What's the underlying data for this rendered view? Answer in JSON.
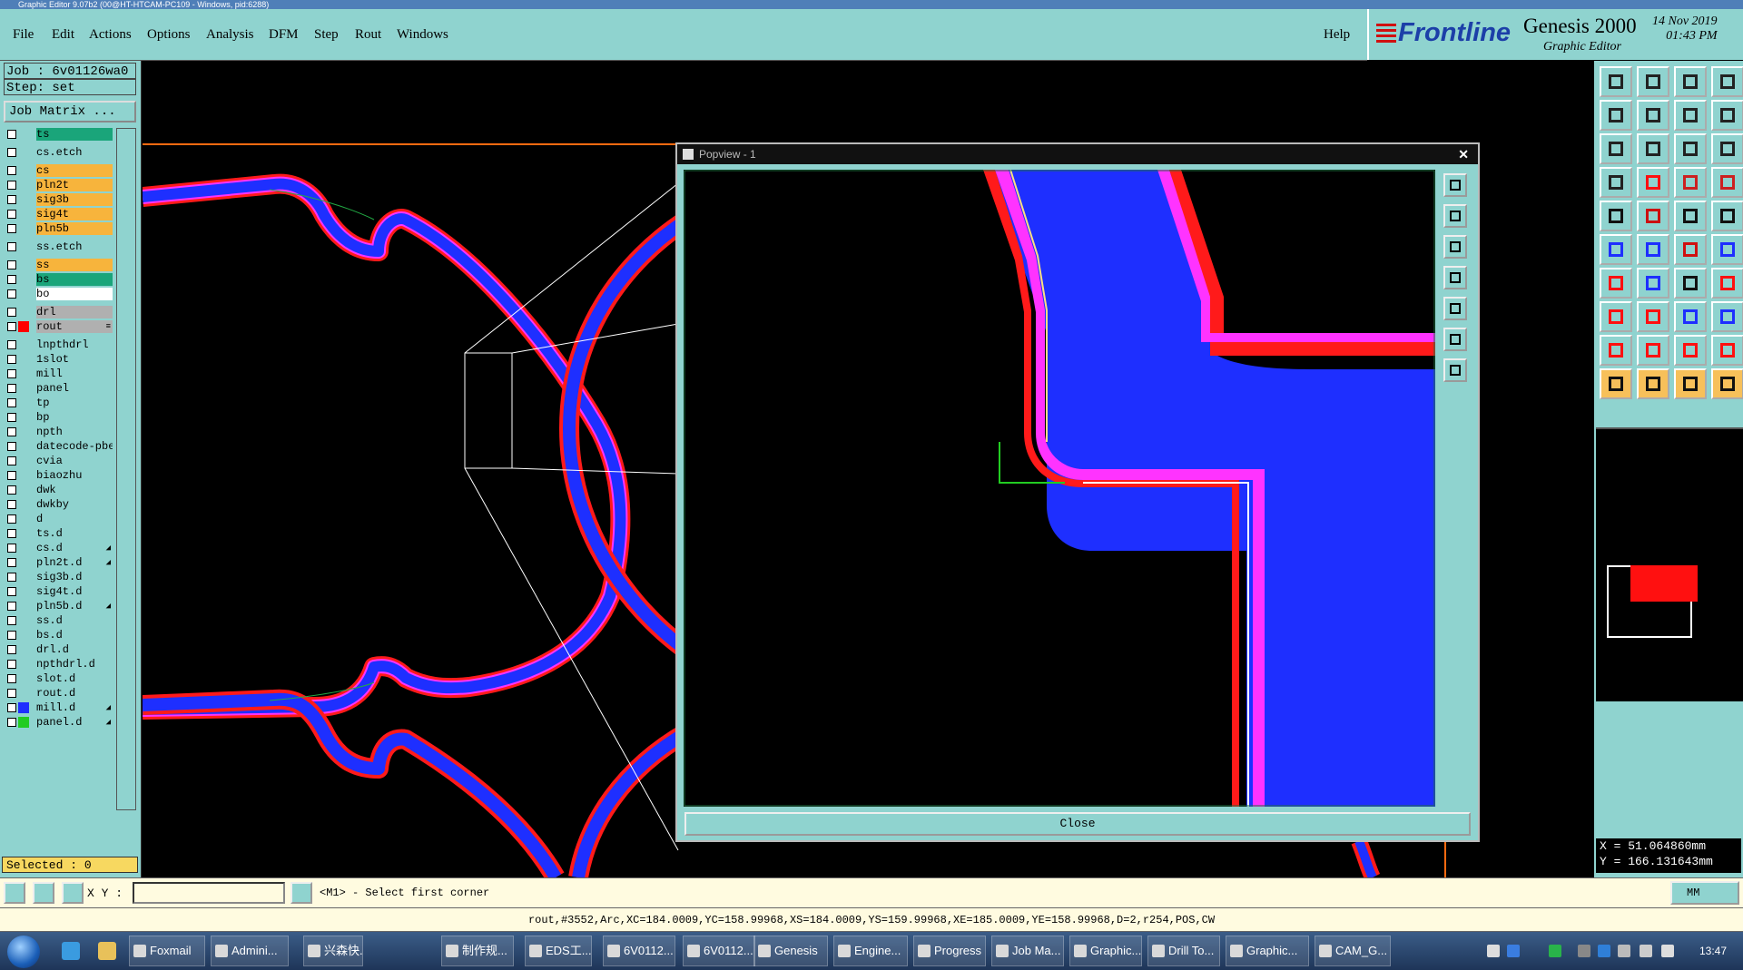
{
  "window": {
    "title": "Graphic Editor 9.07b2 (00@HT-HTCAM-PC109 - Windows, pid:6288)"
  },
  "menu": {
    "items": [
      "File",
      "Edit",
      "Actions",
      "Options",
      "Analysis",
      "DFM",
      "Step",
      "Rout",
      "Windows"
    ],
    "help": "Help"
  },
  "brand": {
    "logo": "Frontline",
    "product": "Genesis 2000",
    "module": "Graphic Editor",
    "date": "14 Nov 2019",
    "time": "01:43 PM"
  },
  "job": {
    "job_line": "Job  :  6v01126wa0",
    "step_line": "Step:  set",
    "matrix_button": "Job Matrix ...",
    "selected": "Selected : 0"
  },
  "layers": [
    {
      "name": "ts",
      "color": "#1aa57a"
    },
    {
      "name": "cs.etch",
      "color": "#8fd3cf"
    },
    {
      "name": "cs",
      "color": "#f7b43c"
    },
    {
      "name": "pln2t",
      "color": "#f7b43c"
    },
    {
      "name": "sig3b",
      "color": "#f7b43c"
    },
    {
      "name": "sig4t",
      "color": "#f7b43c"
    },
    {
      "name": "pln5b",
      "color": "#f7b43c"
    },
    {
      "name": "ss.etch",
      "color": "#8fd3cf"
    },
    {
      "name": "ss",
      "color": "#f7b43c"
    },
    {
      "name": "bs",
      "color": "#1aa57a"
    },
    {
      "name": "bo",
      "color": "#ffffff"
    },
    {
      "name": "drl",
      "color": "#b0b0b0"
    },
    {
      "name": "rout",
      "color": "#b0b0b0",
      "swatch": "#ff0000",
      "edit": "≡"
    },
    {
      "name": "lnpthdrl",
      "color": "#8fd3cf"
    },
    {
      "name": "1slot",
      "color": "#8fd3cf"
    },
    {
      "name": "mill",
      "color": "#8fd3cf"
    },
    {
      "name": "panel",
      "color": "#8fd3cf"
    },
    {
      "name": "tp",
      "color": "#8fd3cf"
    },
    {
      "name": "bp",
      "color": "#8fd3cf"
    },
    {
      "name": "npth",
      "color": "#8fd3cf"
    },
    {
      "name": "datecode-pbe",
      "color": "#8fd3cf"
    },
    {
      "name": "cvia",
      "color": "#8fd3cf"
    },
    {
      "name": "biaozhu",
      "color": "#8fd3cf"
    },
    {
      "name": "dwk",
      "color": "#8fd3cf"
    },
    {
      "name": "dwkby",
      "color": "#8fd3cf"
    },
    {
      "name": "d",
      "color": "#8fd3cf"
    },
    {
      "name": "ts.d",
      "color": "#8fd3cf"
    },
    {
      "name": "cs.d",
      "color": "#8fd3cf",
      "edit": "◢"
    },
    {
      "name": "pln2t.d",
      "color": "#8fd3cf",
      "edit": "◢"
    },
    {
      "name": "sig3b.d",
      "color": "#8fd3cf"
    },
    {
      "name": "sig4t.d",
      "color": "#8fd3cf"
    },
    {
      "name": "pln5b.d",
      "color": "#8fd3cf",
      "edit": "◢"
    },
    {
      "name": "ss.d",
      "color": "#8fd3cf"
    },
    {
      "name": "bs.d",
      "color": "#8fd3cf"
    },
    {
      "name": "drl.d",
      "color": "#8fd3cf"
    },
    {
      "name": "npthdrl.d",
      "color": "#8fd3cf"
    },
    {
      "name": "slot.d",
      "color": "#8fd3cf"
    },
    {
      "name": "rout.d",
      "color": "#8fd3cf"
    },
    {
      "name": "mill.d",
      "color": "#8fd3cf",
      "swatch": "#1e2fff",
      "edit": "◢"
    },
    {
      "name": "panel.d",
      "color": "#8fd3cf",
      "swatch": "#22cc22",
      "edit": "◢"
    }
  ],
  "popview": {
    "title": "Popview - 1",
    "close_label": "Close"
  },
  "coords": {
    "x": "X  =  51.064860mm",
    "y": "Y  =  166.131643mm"
  },
  "command": {
    "xy_label": "X Y :",
    "prompt": "<M1> - Select first corner",
    "units": "MM"
  },
  "status": "rout,#3552,Arc,XC=184.0009,YC=158.99968,XS=184.0009,YS=159.99968,XE=185.0009,YE=158.99968,D=2,r254,POS,CW",
  "taskbar": {
    "tasks": [
      "Foxmail",
      "Admini...",
      "兴森快...",
      "制作规...",
      "EDS工...",
      "6V0112...",
      "6V0112...",
      "Genesis",
      "Engine...",
      "Progress",
      "Job Ma...",
      "Graphic...",
      "Drill To...",
      "Graphic...",
      "CAM_G..."
    ],
    "clock": "13:47"
  },
  "colors": {
    "panel": "#8fd3cf",
    "copper": "#1e2fff",
    "rout": "#ff0000",
    "highlight": "#ff33ff"
  }
}
